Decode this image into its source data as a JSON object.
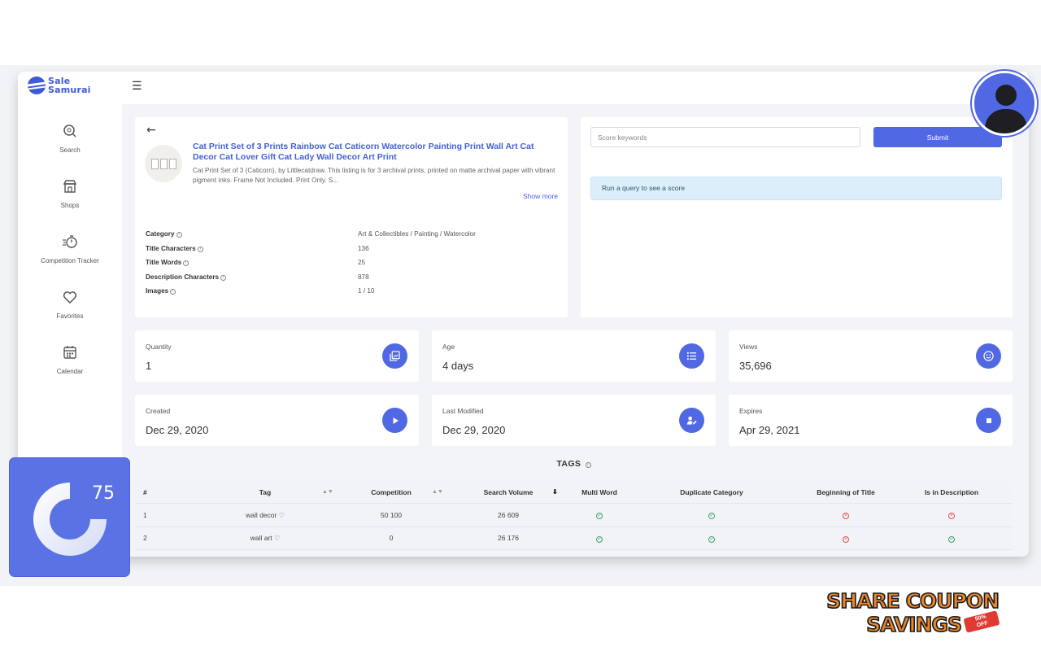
{
  "brand": {
    "name_line1": "Sale",
    "name_line2": "Samurai"
  },
  "sidebar": {
    "items": [
      {
        "label": "Search",
        "icon": "search-icon"
      },
      {
        "label": "Shops",
        "icon": "store-icon"
      },
      {
        "label": "Competition Tracker",
        "icon": "stopwatch-icon"
      },
      {
        "label": "Favorites",
        "icon": "heart-icon"
      },
      {
        "label": "Calendar",
        "icon": "calendar-icon"
      }
    ]
  },
  "listing": {
    "title": "Cat Print Set of 3 Prints Rainbow Cat Caticorn Watercolor Painting Print Wall Art Cat Decor Cat Lover Gift Cat Lady Wall Decor Art Print",
    "description": "Cat Print Set of 3 (Caticorn), by Littlecatdraw. This listing is for 3 archival prints, printed on matte archival paper with vibrant pigment inks. Frame Not Included. Print Only. S...",
    "show_more": "Show more",
    "attributes": [
      {
        "key": "Category",
        "value": "Art & Collectibles / Painting / Watercolor"
      },
      {
        "key": "Title Characters",
        "value": "136"
      },
      {
        "key": "Title Words",
        "value": "25"
      },
      {
        "key": "Description Characters",
        "value": "878"
      },
      {
        "key": "Images",
        "value": "1 / 10"
      }
    ]
  },
  "score": {
    "placeholder": "Score keywords",
    "submit_label": "Submit",
    "message": "Run a query to see a score"
  },
  "stats": [
    {
      "label": "Quantity",
      "value": "1",
      "icon": "images-icon"
    },
    {
      "label": "Age",
      "value": "4 days",
      "icon": "list-icon"
    },
    {
      "label": "Views",
      "value": "35,696",
      "icon": "smile-icon"
    },
    {
      "label": "Created",
      "value": "Dec 29, 2020",
      "icon": "play-icon"
    },
    {
      "label": "Last Modified",
      "value": "Dec 29, 2020",
      "icon": "user-edit-icon"
    },
    {
      "label": "Expires",
      "value": "Apr 29, 2021",
      "icon": "stop-icon"
    }
  ],
  "tags": {
    "title": "TAGS",
    "columns": [
      "#",
      "Tag",
      "Competition",
      "Search Volume",
      "Multi Word",
      "Duplicate Category",
      "Beginning of Title",
      "Is in Description"
    ],
    "rows": [
      {
        "num": "1",
        "tag": "wall decor",
        "competition": "50 100",
        "search_volume": "26 609",
        "multi_word": true,
        "duplicate_category": true,
        "beginning_of_title": false,
        "is_in_description": false
      },
      {
        "num": "2",
        "tag": "wall art",
        "competition": "0",
        "search_volume": "26 176",
        "multi_word": true,
        "duplicate_category": true,
        "beginning_of_title": false,
        "is_in_description": true
      }
    ]
  },
  "badge": {
    "score": "75"
  },
  "promo": {
    "line1": "SHARE COUPON",
    "line2": "SAVINGS",
    "tag_top": "50%",
    "tag_bottom": "OFF"
  },
  "colors": {
    "accent": "#5068e4",
    "link": "#4361d9",
    "ok": "#3aa76d",
    "no": "#e0534f",
    "promo": "#e8862c"
  }
}
